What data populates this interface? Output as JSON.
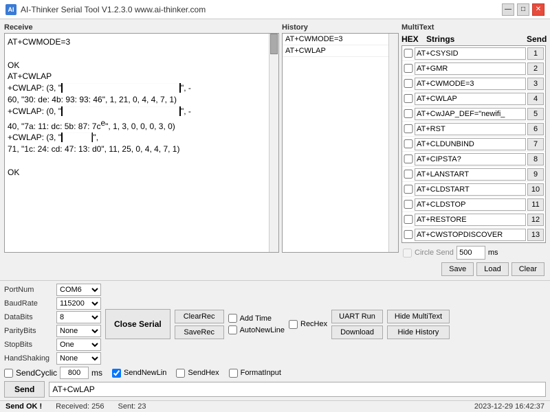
{
  "titleBar": {
    "title": "AI-Thinker Serial Tool V1.2.3.0    www.ai-thinker.com",
    "icon": "AI"
  },
  "receive": {
    "label": "Receive",
    "content": [
      "AT+CWMODE=3",
      "",
      "OK",
      "AT+CWLAP",
      "+CWLAP: (3, \"████████████████\", -",
      "60, \"30: de: 4b: 93: 93: 46\", 1, 21, 0, 4, 4, 7, 1)",
      "+CWLAP: (0, \"████████████████\", -",
      "40, \"7a: 11: dc: 5b: 87: 7c\", 1, 3, 0, 0, 0, 3, 0)",
      "+CWLAP: (3, \"█████\",",
      "71, \"1c: 24: cd: 47: 13: d0\", 11, 25, 0, 4, 4, 7, 1)",
      "",
      "OK"
    ]
  },
  "history": {
    "label": "History",
    "items": [
      "AT+CWMODE=3",
      "AT+CWLAP"
    ]
  },
  "multiText": {
    "label": "MultiText",
    "hexLabel": "HEX",
    "stringsLabel": "Strings",
    "sendLabel": "Send",
    "rows": [
      {
        "hex": false,
        "value": "AT+CSYSID",
        "send": "1"
      },
      {
        "hex": false,
        "value": "AT+GMR",
        "send": "2"
      },
      {
        "hex": false,
        "value": "AT+CWMODE=3",
        "send": "3"
      },
      {
        "hex": false,
        "value": "AT+CWLAP",
        "send": "4"
      },
      {
        "hex": false,
        "value": "AT+CwJAP_DEF=\"newifi_",
        "send": "5"
      },
      {
        "hex": false,
        "value": "AT+RST",
        "send": "6"
      },
      {
        "hex": false,
        "value": "AT+CLDUNBIND",
        "send": "7"
      },
      {
        "hex": false,
        "value": "AT+CIPSTA?",
        "send": "8"
      },
      {
        "hex": false,
        "value": "AT+LANSTART",
        "send": "9"
      },
      {
        "hex": false,
        "value": "AT+CLDSTART",
        "send": "10"
      },
      {
        "hex": false,
        "value": "AT+CLDSTOP",
        "send": "11"
      },
      {
        "hex": false,
        "value": "AT+RESTORE",
        "send": "12"
      },
      {
        "hex": false,
        "value": "AT+CWSTOPDISCOVER",
        "send": "13"
      }
    ],
    "circleSend": {
      "label": "Circle Send",
      "value": "500",
      "msLabel": "ms",
      "checked": false,
      "disabled": true
    },
    "buttons": {
      "save": "Save",
      "load": "Load",
      "clear": "Clear"
    }
  },
  "portSettings": {
    "portNum": {
      "label": "PortNum",
      "value": "COM6"
    },
    "baudRate": {
      "label": "BaudRate",
      "value": "115200"
    },
    "dataBits": {
      "label": "DataBits",
      "value": "8"
    },
    "parityBits": {
      "label": "ParityBits",
      "value": "None"
    },
    "stopBits": {
      "label": "StopBits",
      "value": "One"
    },
    "handShaking": {
      "label": "HandShaking",
      "value": "None"
    }
  },
  "buttons": {
    "closeSerial": "Close Serial",
    "clearRec": "ClearRec",
    "saveRec": "SaveRec",
    "uartRun": "UART Run",
    "download": "Download",
    "hideMultiText": "Hide MultiText",
    "hideHistory": "Hide History",
    "send": "Send"
  },
  "checkboxes": {
    "addTime": {
      "label": "Add Time",
      "checked": false
    },
    "recHex": {
      "label": "RecHex",
      "checked": false
    },
    "autoNewLine": {
      "label": "AutoNewLine",
      "checked": false
    },
    "sendCyclic": {
      "label": "SendCyclic",
      "checked": false
    },
    "sendNewLin": {
      "label": "SendNewLin",
      "checked": true
    },
    "sendHex": {
      "label": "SendHex",
      "checked": false
    },
    "formatInput": {
      "label": "FormatInput",
      "checked": false
    }
  },
  "sendInput": {
    "value": "AT+CwLAP",
    "placeholder": "AT+CwLAP"
  },
  "cyclic": {
    "ms": "800"
  },
  "statusBar": {
    "sendOk": "Send OK !",
    "received": "Received: 256",
    "sent": "Sent: 23",
    "datetime": "2023-12-29 16:42:37"
  }
}
